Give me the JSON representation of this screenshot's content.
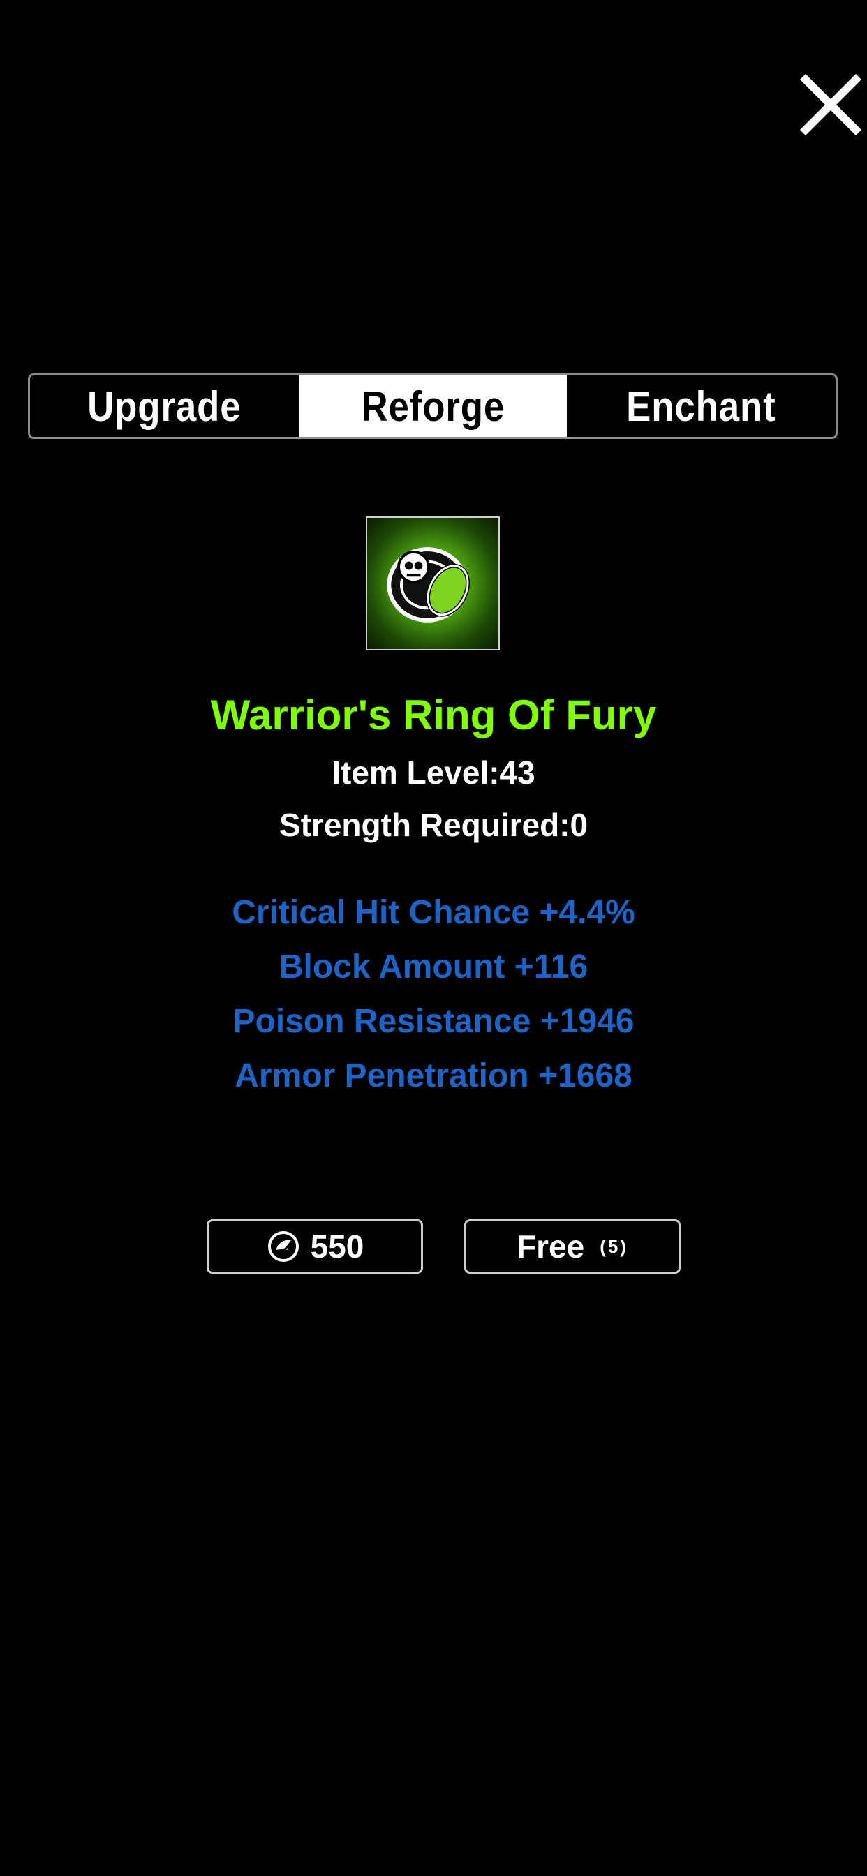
{
  "tabs": [
    {
      "label": "Upgrade",
      "active": false
    },
    {
      "label": "Reforge",
      "active": true
    },
    {
      "label": "Enchant",
      "active": false
    }
  ],
  "item": {
    "icon": "green-ring-icon",
    "name": "Warrior's Ring Of Fury",
    "name_color": "#7fff00",
    "item_level": "Item Level:43",
    "strength_required": "Strength Required:0"
  },
  "stats": [
    "Critical Hit Chance +4.4%",
    "Block Amount +116",
    "Poison Resistance +1946",
    "Armor Penetration +1668"
  ],
  "stat_color": "#1e63c6",
  "buttons": {
    "cost_icon": "reforge-stone-icon",
    "cost_value": "550",
    "free_label": "Free",
    "free_count": "(5)"
  },
  "close_icon": "close-icon"
}
